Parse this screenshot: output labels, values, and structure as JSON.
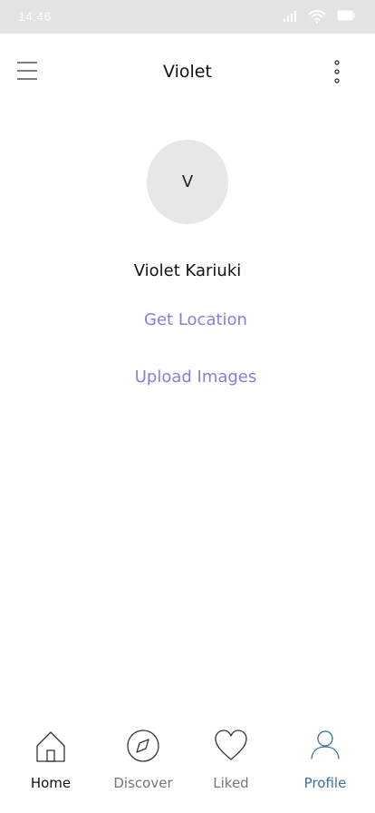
{
  "status_bar": {
    "time": "14:46",
    "icons": [
      "signal-icon",
      "wifi-icon",
      "battery-icon"
    ]
  },
  "app_bar": {
    "title": "Violet",
    "left_icon": "menu-icon",
    "right_icon": "more-vertical-icon"
  },
  "profile": {
    "avatar_initial": "V",
    "name": "Violet Kariuki",
    "actions": {
      "get_location": "Get Location",
      "upload_images": "Upload Images"
    }
  },
  "bottom_nav": {
    "active": "Profile",
    "items": [
      {
        "label": "Home",
        "icon": "home-icon"
      },
      {
        "label": "Discover",
        "icon": "compass-icon"
      },
      {
        "label": "Liked",
        "icon": "heart-icon"
      },
      {
        "label": "Profile",
        "icon": "user-icon"
      }
    ]
  },
  "colors": {
    "accent_link": "#8c7cdf",
    "active_nav": "#3e6e9a",
    "avatar_bg": "#e7e7e7",
    "status_bar_bg": "#e3e3e3"
  }
}
